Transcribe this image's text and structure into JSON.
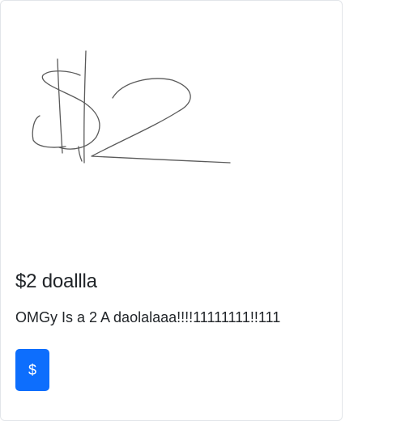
{
  "card": {
    "image_description_icon": "hand-drawn-dollar-sign-2-icon",
    "title": "$2 doallla",
    "text": "OMGy Is a 2 A daolalaaa!!!!11111111!!111",
    "button_label": "$"
  },
  "colors": {
    "button_bg": "#0d6efd",
    "text": "#212529",
    "card_border": "#e2e5e9",
    "sketch_stroke": "#5a5a5a"
  }
}
